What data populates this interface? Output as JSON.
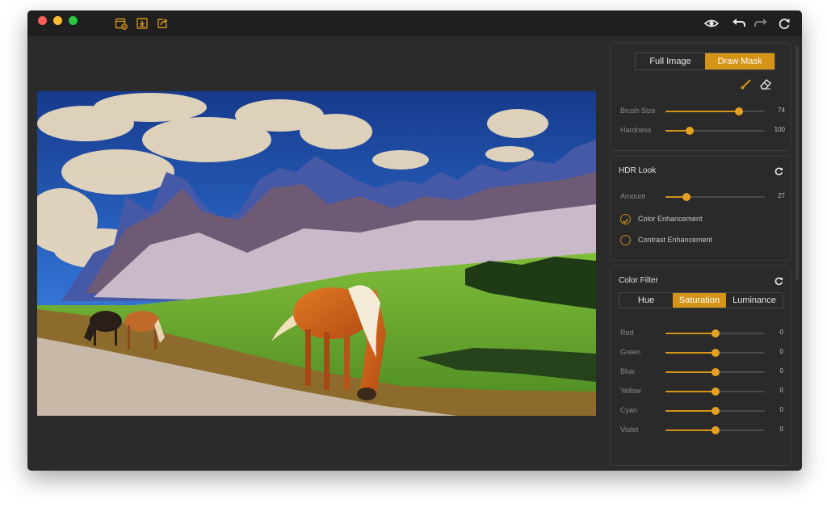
{
  "window": {
    "traffic_lights": [
      "#fe5f57",
      "#febc2e",
      "#28c840"
    ]
  },
  "toolbar": {
    "left_icons": [
      "open-image-icon",
      "import-icon",
      "export-icon"
    ],
    "right_icons": [
      "preview-eye-icon",
      "undo-icon",
      "redo-icon",
      "refresh-icon"
    ],
    "accent": "#d49418"
  },
  "mask_panel": {
    "tabs": [
      {
        "label": "Full Image",
        "active": false
      },
      {
        "label": "Draw Mask",
        "active": true
      }
    ],
    "tools": [
      "brush-icon",
      "eraser-icon"
    ],
    "sliders": [
      {
        "label": "Brush Size",
        "value": "74",
        "level": 0.74
      },
      {
        "label": "Hardness",
        "value": "100",
        "level": 0.24
      }
    ]
  },
  "hdr_panel": {
    "title": "HDR Look",
    "sliders": [
      {
        "label": "Amount",
        "value": "27",
        "level": 0.21
      }
    ],
    "options": [
      {
        "label": "Color Enhancement",
        "checked": true
      },
      {
        "label": "Contrast Enhancement",
        "checked": false
      }
    ]
  },
  "color_filter_panel": {
    "title": "Color Filter",
    "tabs": [
      {
        "label": "Hue",
        "active": false
      },
      {
        "label": "Saturation",
        "active": true
      },
      {
        "label": "Luminance",
        "active": false
      }
    ],
    "sliders": [
      {
        "label": "Red",
        "value": "0",
        "level": 0.5
      },
      {
        "label": "Green",
        "value": "0",
        "level": 0.5
      },
      {
        "label": "Blue",
        "value": "0",
        "level": 0.5
      },
      {
        "label": "Yellow",
        "value": "0",
        "level": 0.5
      },
      {
        "label": "Cyan",
        "value": "0",
        "level": 0.5
      },
      {
        "label": "Violet",
        "value": "0",
        "level": 0.5
      }
    ]
  }
}
